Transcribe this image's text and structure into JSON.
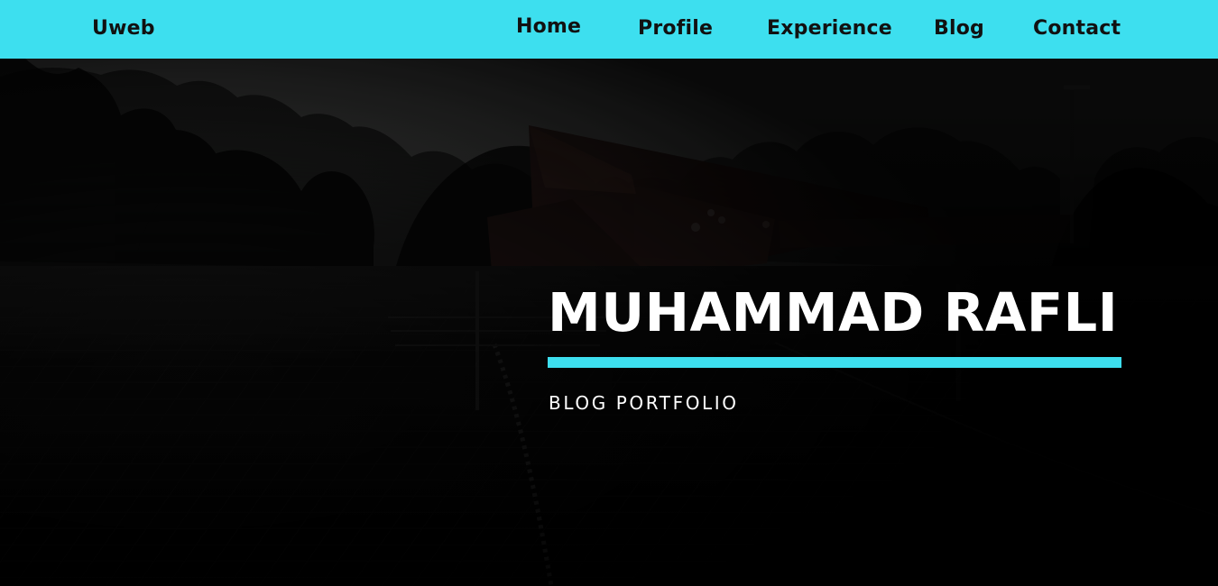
{
  "brand": {
    "name": "Uweb"
  },
  "nav": {
    "home": "Home",
    "profile": "Profile",
    "experience": "Experience",
    "blog": "Blog",
    "contact": "Contact"
  },
  "hero": {
    "title": "MUHAMMAD RAFLI",
    "subtitle": "BLOG PORTFOLIO",
    "accent_color": "#3ddfef",
    "background": "darkened monochrome park photo"
  }
}
